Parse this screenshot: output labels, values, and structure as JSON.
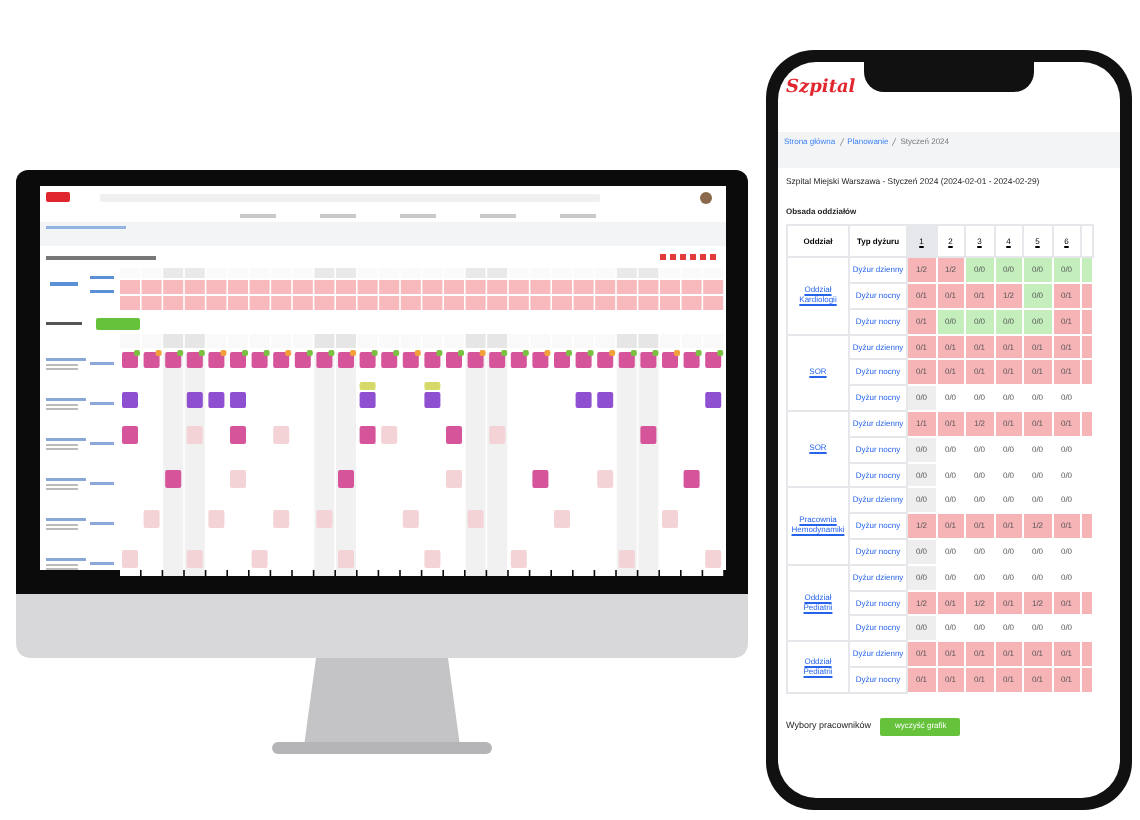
{
  "phone": {
    "logo": "Szpital",
    "breadcrumb": [
      "Strona główna",
      "Planowanie",
      "Styczeń 2024"
    ],
    "title": "Szpital Miejski Warszawa - Styczeń 2024 (2024-02-01 - 2024-02-29)",
    "section": "Obsada oddziałów",
    "columns": [
      "Oddział",
      "Typ dyżuru"
    ],
    "days": [
      {
        "label": "1",
        "weekend": true
      },
      {
        "label": "2",
        "weekend": false
      },
      {
        "label": "3",
        "weekend": false
      },
      {
        "label": "4",
        "weekend": false
      },
      {
        "label": "5",
        "weekend": false
      },
      {
        "label": "6",
        "weekend": false
      }
    ],
    "departments": [
      {
        "name": "Oddział Kardiologii",
        "rows": [
          {
            "type": "Dyżur dzienny",
            "cells": [
              {
                "value": "1/2",
                "kind": "short"
              },
              {
                "value": "1/2",
                "kind": "short"
              },
              {
                "value": "0/0",
                "kind": "ok"
              },
              {
                "value": "0/0",
                "kind": "ok"
              },
              {
                "value": "0/0",
                "kind": "ok"
              },
              {
                "value": "0/0",
                "kind": "ok"
              }
            ]
          },
          {
            "type": "Dyżur nocny",
            "cells": [
              {
                "value": "0/1",
                "kind": "short"
              },
              {
                "value": "0/1",
                "kind": "short"
              },
              {
                "value": "0/1",
                "kind": "short"
              },
              {
                "value": "1/2",
                "kind": "short"
              },
              {
                "value": "0/0",
                "kind": "ok"
              },
              {
                "value": "0/1",
                "kind": "short"
              }
            ]
          },
          {
            "type": "Dyżur nocny",
            "cells": [
              {
                "value": "0/1",
                "kind": "short"
              },
              {
                "value": "0/0",
                "kind": "ok"
              },
              {
                "value": "0/0",
                "kind": "ok"
              },
              {
                "value": "0/0",
                "kind": "ok"
              },
              {
                "value": "0/0",
                "kind": "ok"
              },
              {
                "value": "0/1",
                "kind": "short"
              }
            ]
          }
        ]
      },
      {
        "name": "SOR",
        "rows": [
          {
            "type": "Dyżur dzienny",
            "cells": [
              {
                "value": "0/1",
                "kind": "short"
              },
              {
                "value": "0/1",
                "kind": "short"
              },
              {
                "value": "0/1",
                "kind": "short"
              },
              {
                "value": "0/1",
                "kind": "short"
              },
              {
                "value": "0/1",
                "kind": "short"
              },
              {
                "value": "0/1",
                "kind": "short"
              }
            ]
          },
          {
            "type": "Dyżur nocny",
            "cells": [
              {
                "value": "0/1",
                "kind": "short"
              },
              {
                "value": "0/1",
                "kind": "short"
              },
              {
                "value": "0/1",
                "kind": "short"
              },
              {
                "value": "0/1",
                "kind": "short"
              },
              {
                "value": "0/1",
                "kind": "short"
              },
              {
                "value": "0/1",
                "kind": "short"
              }
            ]
          },
          {
            "type": "Dyżur nocny",
            "cells": [
              {
                "value": "0/0",
                "kind": "empty"
              },
              {
                "value": "0/0",
                "kind": "empty"
              },
              {
                "value": "0/0",
                "kind": "empty"
              },
              {
                "value": "0/0",
                "kind": "empty"
              },
              {
                "value": "0/0",
                "kind": "empty"
              },
              {
                "value": "0/0",
                "kind": "empty"
              }
            ]
          }
        ]
      },
      {
        "name": "SOR",
        "rows": [
          {
            "type": "Dyżur dzienny",
            "cells": [
              {
                "value": "1/1",
                "kind": "short"
              },
              {
                "value": "0/1",
                "kind": "short"
              },
              {
                "value": "1/2",
                "kind": "short"
              },
              {
                "value": "0/1",
                "kind": "short"
              },
              {
                "value": "0/1",
                "kind": "short"
              },
              {
                "value": "0/1",
                "kind": "short"
              }
            ]
          },
          {
            "type": "Dyżur nocny",
            "cells": [
              {
                "value": "0/0",
                "kind": "empty"
              },
              {
                "value": "0/0",
                "kind": "empty"
              },
              {
                "value": "0/0",
                "kind": "empty"
              },
              {
                "value": "0/0",
                "kind": "empty"
              },
              {
                "value": "0/0",
                "kind": "empty"
              },
              {
                "value": "0/0",
                "kind": "empty"
              }
            ]
          },
          {
            "type": "Dyżur nocny",
            "cells": [
              {
                "value": "0/0",
                "kind": "empty"
              },
              {
                "value": "0/0",
                "kind": "empty"
              },
              {
                "value": "0/0",
                "kind": "empty"
              },
              {
                "value": "0/0",
                "kind": "empty"
              },
              {
                "value": "0/0",
                "kind": "empty"
              },
              {
                "value": "0/0",
                "kind": "empty"
              }
            ]
          }
        ]
      },
      {
        "name": "Pracownia Hemodynamiki",
        "rows": [
          {
            "type": "Dyżur dzienny",
            "cells": [
              {
                "value": "0/0",
                "kind": "empty"
              },
              {
                "value": "0/0",
                "kind": "empty"
              },
              {
                "value": "0/0",
                "kind": "empty"
              },
              {
                "value": "0/0",
                "kind": "empty"
              },
              {
                "value": "0/0",
                "kind": "empty"
              },
              {
                "value": "0/0",
                "kind": "empty"
              }
            ]
          },
          {
            "type": "Dyżur nocny",
            "cells": [
              {
                "value": "1/2",
                "kind": "short"
              },
              {
                "value": "0/1",
                "kind": "short"
              },
              {
                "value": "0/1",
                "kind": "short"
              },
              {
                "value": "0/1",
                "kind": "short"
              },
              {
                "value": "1/2",
                "kind": "short"
              },
              {
                "value": "0/1",
                "kind": "short"
              }
            ]
          },
          {
            "type": "Dyżur nocny",
            "cells": [
              {
                "value": "0/0",
                "kind": "empty"
              },
              {
                "value": "0/0",
                "kind": "empty"
              },
              {
                "value": "0/0",
                "kind": "empty"
              },
              {
                "value": "0/0",
                "kind": "empty"
              },
              {
                "value": "0/0",
                "kind": "empty"
              },
              {
                "value": "0/0",
                "kind": "empty"
              }
            ]
          }
        ]
      },
      {
        "name": "Oddział Pediatrii",
        "rows": [
          {
            "type": "Dyżur dzienny",
            "cells": [
              {
                "value": "0/0",
                "kind": "empty"
              },
              {
                "value": "0/0",
                "kind": "empty"
              },
              {
                "value": "0/0",
                "kind": "empty"
              },
              {
                "value": "0/0",
                "kind": "empty"
              },
              {
                "value": "0/0",
                "kind": "empty"
              },
              {
                "value": "0/0",
                "kind": "empty"
              }
            ]
          },
          {
            "type": "Dyżur nocny",
            "cells": [
              {
                "value": "1/2",
                "kind": "short"
              },
              {
                "value": "0/1",
                "kind": "short"
              },
              {
                "value": "1/2",
                "kind": "short"
              },
              {
                "value": "0/1",
                "kind": "short"
              },
              {
                "value": "1/2",
                "kind": "short"
              },
              {
                "value": "0/1",
                "kind": "short"
              }
            ]
          },
          {
            "type": "Dyżur nocny",
            "cells": [
              {
                "value": "0/0",
                "kind": "empty"
              },
              {
                "value": "0/0",
                "kind": "empty"
              },
              {
                "value": "0/0",
                "kind": "empty"
              },
              {
                "value": "0/0",
                "kind": "empty"
              },
              {
                "value": "0/0",
                "kind": "empty"
              },
              {
                "value": "0/0",
                "kind": "empty"
              }
            ]
          }
        ]
      },
      {
        "name": "Oddział Pediatrii",
        "rows": [
          {
            "type": "Dyżur dzienny",
            "cells": [
              {
                "value": "0/1",
                "kind": "short"
              },
              {
                "value": "0/1",
                "kind": "short"
              },
              {
                "value": "0/1",
                "kind": "short"
              },
              {
                "value": "0/1",
                "kind": "short"
              },
              {
                "value": "0/1",
                "kind": "short"
              },
              {
                "value": "0/1",
                "kind": "short"
              }
            ]
          },
          {
            "type": "Dyżur nocny",
            "cells": [
              {
                "value": "0/1",
                "kind": "short"
              },
              {
                "value": "0/1",
                "kind": "short"
              },
              {
                "value": "0/1",
                "kind": "short"
              },
              {
                "value": "0/1",
                "kind": "short"
              },
              {
                "value": "0/1",
                "kind": "short"
              },
              {
                "value": "0/1",
                "kind": "short"
              }
            ]
          }
        ]
      }
    ],
    "footer_label": "Wybory pracowników",
    "button": "wyczyść grafik"
  }
}
